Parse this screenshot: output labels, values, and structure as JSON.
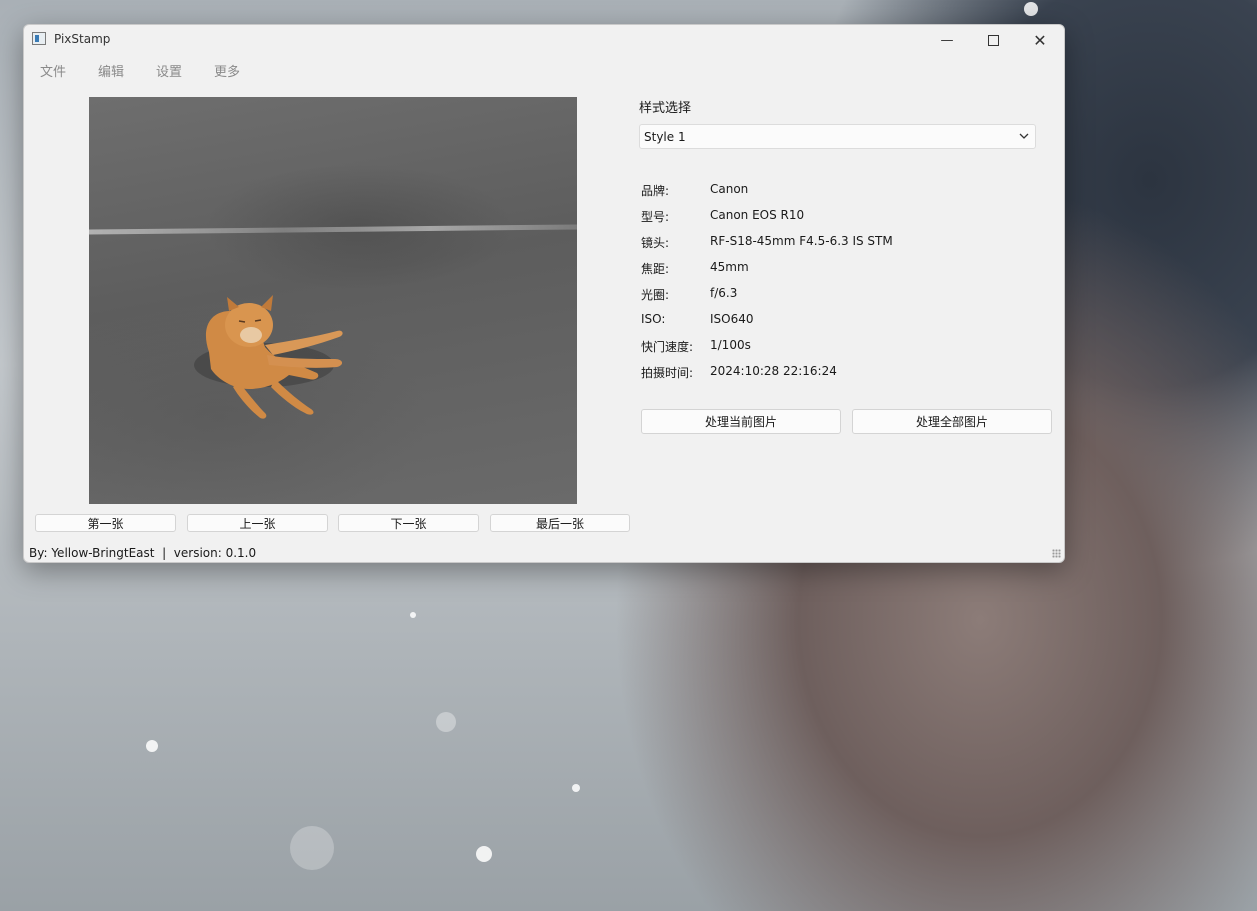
{
  "window": {
    "title": "PixStamp",
    "minimize_glyph": "—",
    "close_glyph": "✕"
  },
  "menu": {
    "items": [
      "文件",
      "编辑",
      "设置",
      "更多"
    ]
  },
  "navigation": {
    "first": "第一张",
    "previous": "上一张",
    "next": "下一张",
    "last": "最后一张"
  },
  "style_picker": {
    "label": "样式选择",
    "selected": "Style 1"
  },
  "exif": [
    {
      "key": "品牌:",
      "value": "Canon"
    },
    {
      "key": "型号:",
      "value": "Canon EOS R10"
    },
    {
      "key": "镜头:",
      "value": "RF-S18-45mm F4.5-6.3 IS STM"
    },
    {
      "key": "焦距:",
      "value": "45mm"
    },
    {
      "key": "光圈:",
      "value": "f/6.3"
    },
    {
      "key": "ISO:",
      "value": "ISO640"
    },
    {
      "key": "快门速度:",
      "value": "1/100s"
    },
    {
      "key": "拍摄时间:",
      "value": "2024:10:28 22:16:24"
    }
  ],
  "actions": {
    "process_current": "处理当前图片",
    "process_all": "处理全部图片"
  },
  "status_bar": {
    "text": "By: Yellow-BringtEast  |  version: 0.1.0"
  },
  "colors": {
    "window_bg": "#f1f1f1",
    "button_bg": "#fbfbfb",
    "border": "#d4d4d4"
  },
  "icons": {
    "app": "app-icon",
    "minimize": "minimize-icon",
    "maximize": "maximize-icon",
    "close": "close-icon",
    "dropdown": "chevron-down-icon"
  }
}
